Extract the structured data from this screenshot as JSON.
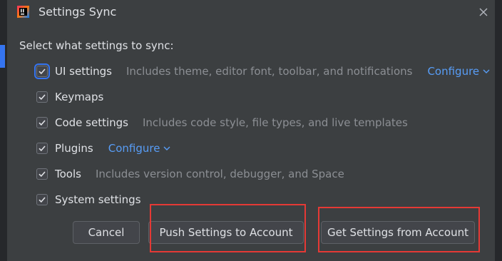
{
  "dialog": {
    "title": "Settings Sync",
    "app_icon": "intellij-idea-icon",
    "close_icon": "close-icon"
  },
  "section_label": "Select what settings to sync:",
  "items": [
    {
      "label": "UI settings",
      "checked": true,
      "focused": true,
      "description": "Includes theme, editor font, toolbar, and notifications",
      "configure": "Configure"
    },
    {
      "label": "Keymaps",
      "checked": true
    },
    {
      "label": "Code settings",
      "checked": true,
      "description": "Includes code style, file types, and live templates"
    },
    {
      "label": "Plugins",
      "checked": true,
      "configure": "Configure"
    },
    {
      "label": "Tools",
      "checked": true,
      "description": "Includes version control, debugger, and Space"
    },
    {
      "label": "System settings",
      "checked": true
    }
  ],
  "buttons": {
    "cancel": "Cancel",
    "push": "Push Settings to Account",
    "get": "Get Settings from Account"
  },
  "colors": {
    "accent": "#3574f0",
    "link": "#589df6",
    "highlight": "#e53935",
    "background": "#3c3f41"
  }
}
